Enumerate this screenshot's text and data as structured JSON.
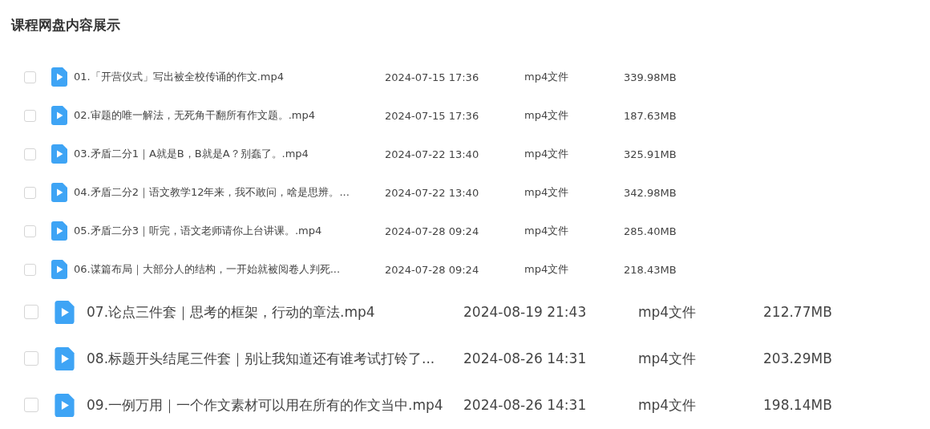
{
  "title": "课程网盘内容展示",
  "files": [
    {
      "kind": "small",
      "checked": false,
      "name": "01.「开营仪式」写出被全校传诵的作文.mp4",
      "date": "2024-07-15 17:36",
      "type": "mp4文件",
      "size": "339.98MB"
    },
    {
      "kind": "small",
      "checked": false,
      "name": "02.审题的唯一解法，无死角干翻所有作文题。.mp4",
      "date": "2024-07-15 17:36",
      "type": "mp4文件",
      "size": "187.63MB"
    },
    {
      "kind": "small",
      "checked": false,
      "name": "03.矛盾二分1｜A就是B，B就是A？别蠢了。.mp4",
      "date": "2024-07-22 13:40",
      "type": "mp4文件",
      "size": "325.91MB"
    },
    {
      "kind": "small",
      "checked": false,
      "name": "04.矛盾二分2｜语文教学12年来，我不敢问，啥是思辨。...",
      "date": "2024-07-22 13:40",
      "type": "mp4文件",
      "size": "342.98MB"
    },
    {
      "kind": "small",
      "checked": false,
      "name": "05.矛盾二分3｜听完，语文老师请你上台讲课。.mp4",
      "date": "2024-07-28 09:24",
      "type": "mp4文件",
      "size": "285.40MB"
    },
    {
      "kind": "small",
      "checked": false,
      "name": "06.谋篇布局｜大部分人的结构，一开始就被阅卷人判死...",
      "date": "2024-07-28 09:24",
      "type": "mp4文件",
      "size": "218.43MB"
    },
    {
      "kind": "large",
      "checked": false,
      "name": "07.论点三件套｜思考的框架，行动的章法.mp4",
      "date": "2024-08-19 21:43",
      "type": "mp4文件",
      "size": "212.77MB"
    },
    {
      "kind": "large",
      "checked": false,
      "name": "08.标题开头结尾三件套｜别让我知道还有谁考试打铃了...",
      "date": "2024-08-26 14:31",
      "type": "mp4文件",
      "size": "203.29MB"
    },
    {
      "kind": "large",
      "checked": false,
      "name": "09.一例万用｜一个作文素材可以用在所有的作文当中.mp4",
      "date": "2024-08-26 14:31",
      "type": "mp4文件",
      "size": "198.14MB"
    }
  ]
}
